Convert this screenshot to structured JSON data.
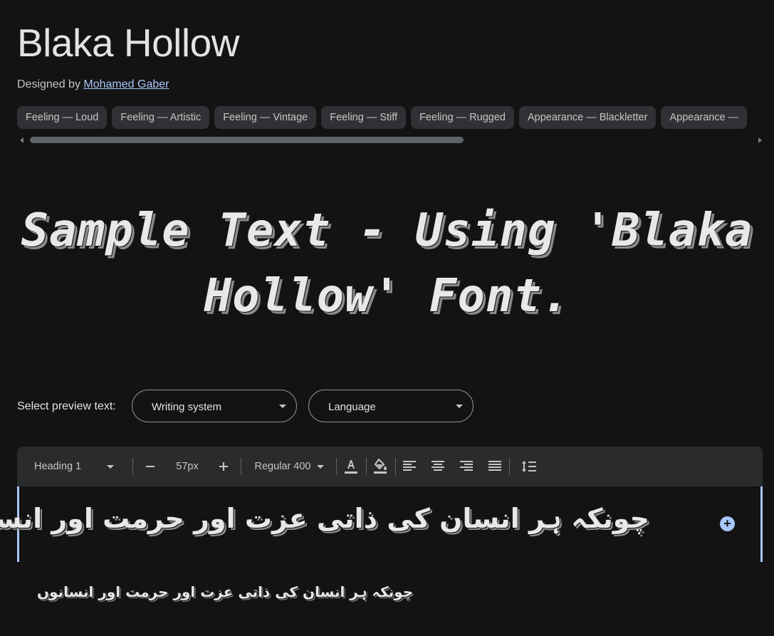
{
  "font": {
    "name": "Blaka Hollow",
    "designed_by_label": "Designed by",
    "designer": "Mohamed Gaber"
  },
  "tags": [
    "Feeling — Loud",
    "Feeling — Artistic",
    "Feeling — Vintage",
    "Feeling — Stiff",
    "Feeling — Rugged",
    "Appearance — Blackletter",
    "Appearance —"
  ],
  "sample": {
    "text": "Sample Text - Using 'Blaka Hollow' Font."
  },
  "preview": {
    "label": "Select preview text:",
    "writing_system": "Writing system",
    "language": "Language"
  },
  "toolbar": {
    "style": "Heading 1",
    "decrease_icon": "minus-icon",
    "size": "57px",
    "increase_icon": "plus-icon",
    "weight": "Regular 400",
    "text_color_icon": "text-color-icon",
    "fill_color_icon": "fill-color-icon",
    "align_left_icon": "align-left-icon",
    "align_center_icon": "align-center-icon",
    "align_right_icon": "align-right-icon",
    "align_justify_icon": "align-justify-icon",
    "line_height_icon": "line-height-icon"
  },
  "editor": {
    "heading_text": "چونکہ ہر انسان کی ذاتی عزت اور حرمت اور انسانوں",
    "paragraph_text": "چونکہ ہر انسان کی ذاتی عزت اور حرمت اور انسانوں",
    "add_icon": "add-circle-icon"
  },
  "colors": {
    "background": "#131314",
    "accent": "#a8c7fa",
    "chip_bg": "#303134",
    "toolbar_bg": "#2a2b2d"
  }
}
